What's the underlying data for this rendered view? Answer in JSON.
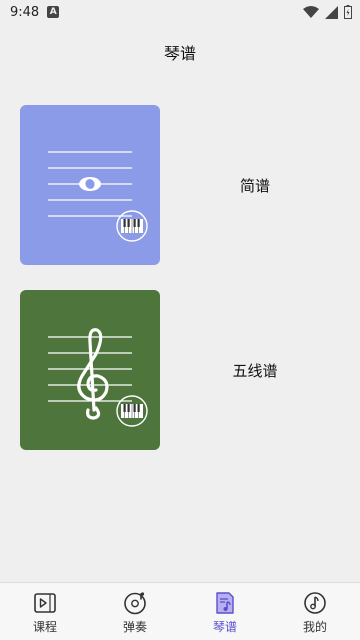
{
  "status_bar": {
    "time": "9:48",
    "notification_glyph": "A"
  },
  "page": {
    "title": "琴谱"
  },
  "cards": [
    {
      "label": "简谱",
      "color": "#8C9BE8"
    },
    {
      "label": "五线谱",
      "color": "#4E763C"
    }
  ],
  "tabs": [
    {
      "label": "课程",
      "icon": "play-lesson-icon"
    },
    {
      "label": "弹奏",
      "icon": "music-disc-icon"
    },
    {
      "label": "琴谱",
      "icon": "sheet-music-icon",
      "active": true
    },
    {
      "label": "我的",
      "icon": "profile-disc-icon"
    }
  ],
  "colors": {
    "accent": "#5A4FCF"
  }
}
